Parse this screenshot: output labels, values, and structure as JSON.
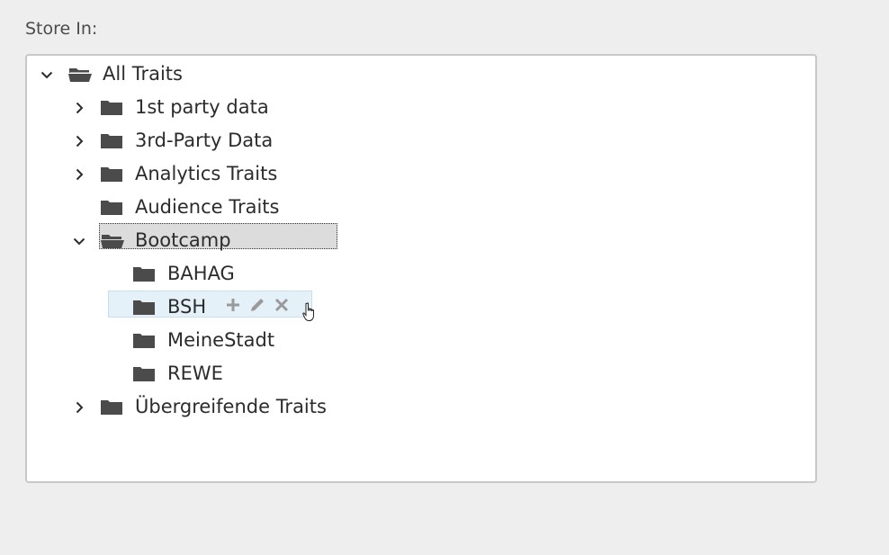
{
  "store_label": "Store In:",
  "tree": {
    "root": {
      "label": "All Traits",
      "expanded": true
    },
    "items": [
      {
        "label": "1st party data",
        "chevron": "chevron-right-icon"
      },
      {
        "label": "3rd-Party Data",
        "chevron": "chevron-right-icon"
      },
      {
        "label": "Analytics Traits",
        "chevron": "chevron-right-icon"
      },
      {
        "label": "Audience Traits",
        "chevron": ""
      },
      {
        "label": "Bootcamp",
        "chevron": "chevron-down-icon",
        "selected": true
      },
      {
        "label": "BAHAG"
      },
      {
        "label": "BSH",
        "hovered": true
      },
      {
        "label": "MeineStadt"
      },
      {
        "label": "REWE"
      },
      {
        "label": "Übergreifende Traits",
        "chevron": "chevron-right-icon"
      }
    ]
  },
  "colors": {
    "background": "#eeeeee",
    "tree_bg": "#ffffff",
    "selected_bg": "#dcdcdc",
    "hover_bg": "#e4f1f8",
    "folder": "#4b4b4b",
    "action_icons": "#9a9a9a"
  }
}
